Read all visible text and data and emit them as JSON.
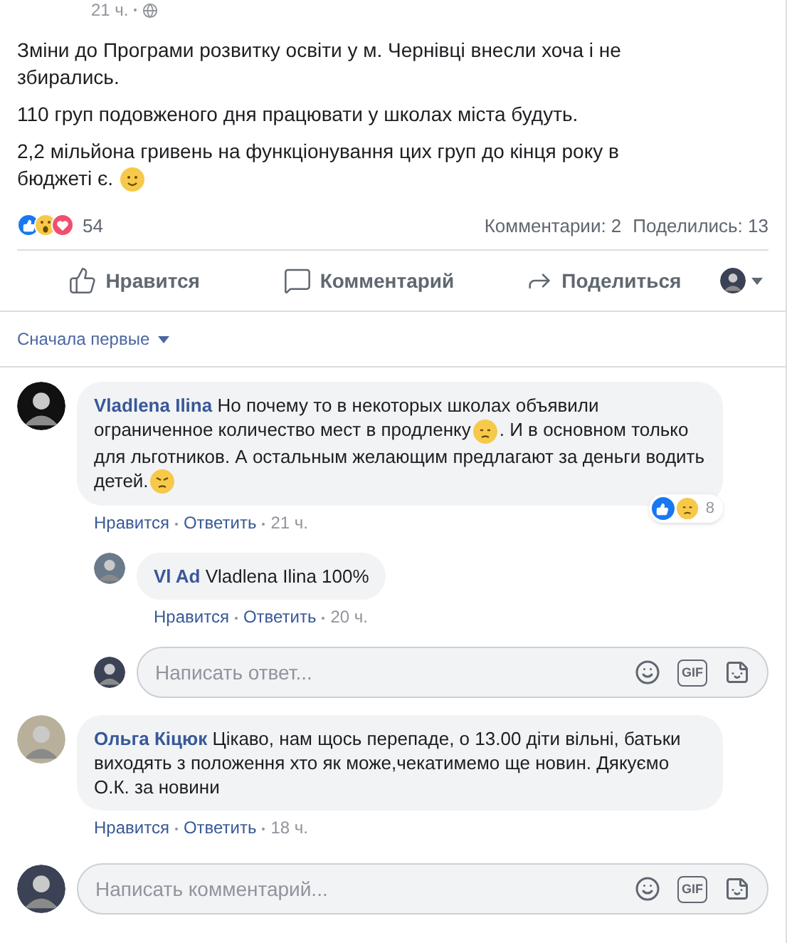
{
  "post": {
    "time": "21 ч.",
    "paragraphs": [
      [
        {
          "kind": "text",
          "text": "Зміни до Програми розвитку освіти у м. Чернівці внесли хоча і не збирались."
        }
      ],
      [
        {
          "kind": "text",
          "text": "110 груп подовженого дня працювати у школах міста будуть."
        }
      ],
      [
        {
          "kind": "text",
          "text": "2,2 мільйона гривень на функціонування цих груп до кінця року в бюджеті є. "
        },
        {
          "kind": "smile"
        }
      ]
    ],
    "reaction_count": "54",
    "comments_count": "Комментарии: 2",
    "shares_count": "Поделились: 13"
  },
  "actions": [
    "Нравится",
    "Комментарий",
    "Поделиться"
  ],
  "sort": {
    "label": "Сначала первые"
  },
  "comments": [
    {
      "author": "Vladlena Ilina",
      "body": [
        {
          "kind": "text",
          "text": "Но почему то в некоторых школах объявили ограниченное количество мест в продленку"
        },
        {
          "kind": "sad"
        },
        {
          "kind": "text",
          "text": ". И в основном только для льготников. А остальным желающим предлагают за деньги водить детей."
        },
        {
          "kind": "angry"
        }
      ],
      "like": "Нравится",
      "reply": "Ответить",
      "time": "21 ч.",
      "reactions": {
        "count": "8"
      },
      "replies": [
        {
          "author": "Vl Ad",
          "body": [
            {
              "kind": "text",
              "text": "Vladlena Ilina 100%"
            }
          ],
          "like": "Нравится",
          "reply": "Ответить",
          "time": "20 ч."
        }
      ],
      "reply_field": {
        "placeholder": "Написать ответ...",
        "gif_label": "GIF"
      }
    },
    {
      "author": "Ольга Кіцюк",
      "body": [
        {
          "kind": "text",
          "text": "Цікаво, нам щось перепаде, о 13.00 діти вільні, батьки виходять з положення хто як може,чекатимемо ще новин. Дякуємо О.К. за новини"
        }
      ],
      "like": "Нравится",
      "reply": "Ответить",
      "time": "18 ч."
    }
  ],
  "comment_field": {
    "placeholder": "Написать комментарий...",
    "gif_label": "GIF"
  }
}
